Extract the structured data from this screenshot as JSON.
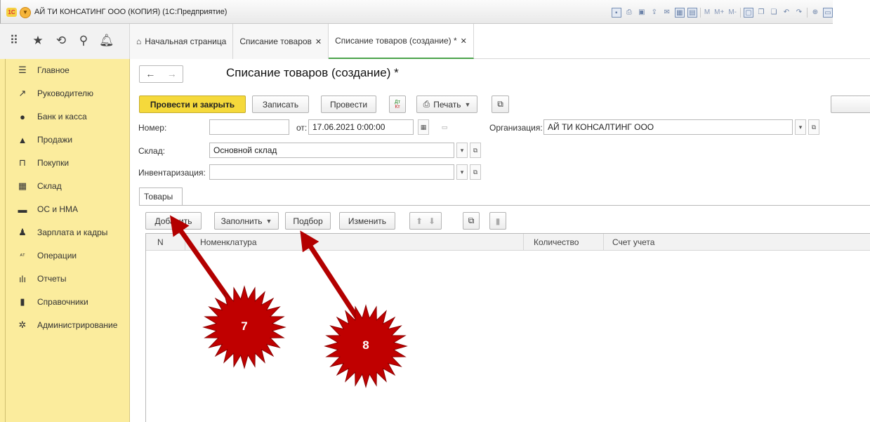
{
  "app": {
    "title": "АЙ ТИ КОНСАТИНГ ООО (КОПИЯ)  (1С:Предприятие)",
    "logo_text": "1С",
    "toolbar_memory": [
      "M",
      "M+",
      "M-"
    ]
  },
  "tabs": [
    {
      "label": "Начальная страница",
      "closable": false,
      "active": false
    },
    {
      "label": "Списание товаров",
      "closable": true,
      "active": false
    },
    {
      "label": "Списание товаров (создание) *",
      "closable": true,
      "active": true
    }
  ],
  "sidebar": {
    "items": [
      {
        "label": "Главное",
        "icon": "menu-icon"
      },
      {
        "label": "Руководителю",
        "icon": "trend-icon"
      },
      {
        "label": "Банк и касса",
        "icon": "ruble-icon"
      },
      {
        "label": "Продажи",
        "icon": "bag-icon"
      },
      {
        "label": "Покупки",
        "icon": "cart-icon"
      },
      {
        "label": "Склад",
        "icon": "warehouse-icon"
      },
      {
        "label": "ОС и НМА",
        "icon": "truck-icon"
      },
      {
        "label": "Зарплата и кадры",
        "icon": "person-icon"
      },
      {
        "label": "Операции",
        "icon": "dt-kt-icon"
      },
      {
        "label": "Отчеты",
        "icon": "bar-chart-icon"
      },
      {
        "label": "Справочники",
        "icon": "book-icon"
      },
      {
        "label": "Администрирование",
        "icon": "gear-icon"
      }
    ]
  },
  "form": {
    "title": "Списание товаров (создание) *",
    "buttons": {
      "post_close": "Провести и закрыть",
      "save": "Записать",
      "post": "Провести",
      "dtkt_top": "Дт",
      "dtkt_bottom": "Кт",
      "print": "Печать"
    },
    "fields": {
      "number_label": "Номер:",
      "number_value": "",
      "date_label": "от:",
      "date_value": "17.06.2021  0:00:00",
      "org_label": "Организация:",
      "org_value": "АЙ ТИ КОНСАЛТИНГ ООО",
      "warehouse_label": "Склад:",
      "warehouse_value": "Основной склад",
      "inventory_label": "Инвентаризация:",
      "inventory_value": ""
    },
    "tab_goods": "Товары",
    "table_buttons": {
      "add": "Добавить",
      "fill": "Заполнить",
      "pick": "Подбор",
      "change": "Изменить"
    },
    "columns": [
      "N",
      "Номенклатура",
      "Количество",
      "Счет учета"
    ]
  },
  "annotations": {
    "marker_7": "7",
    "marker_8": "8",
    "arrow_color": "#b30000"
  }
}
